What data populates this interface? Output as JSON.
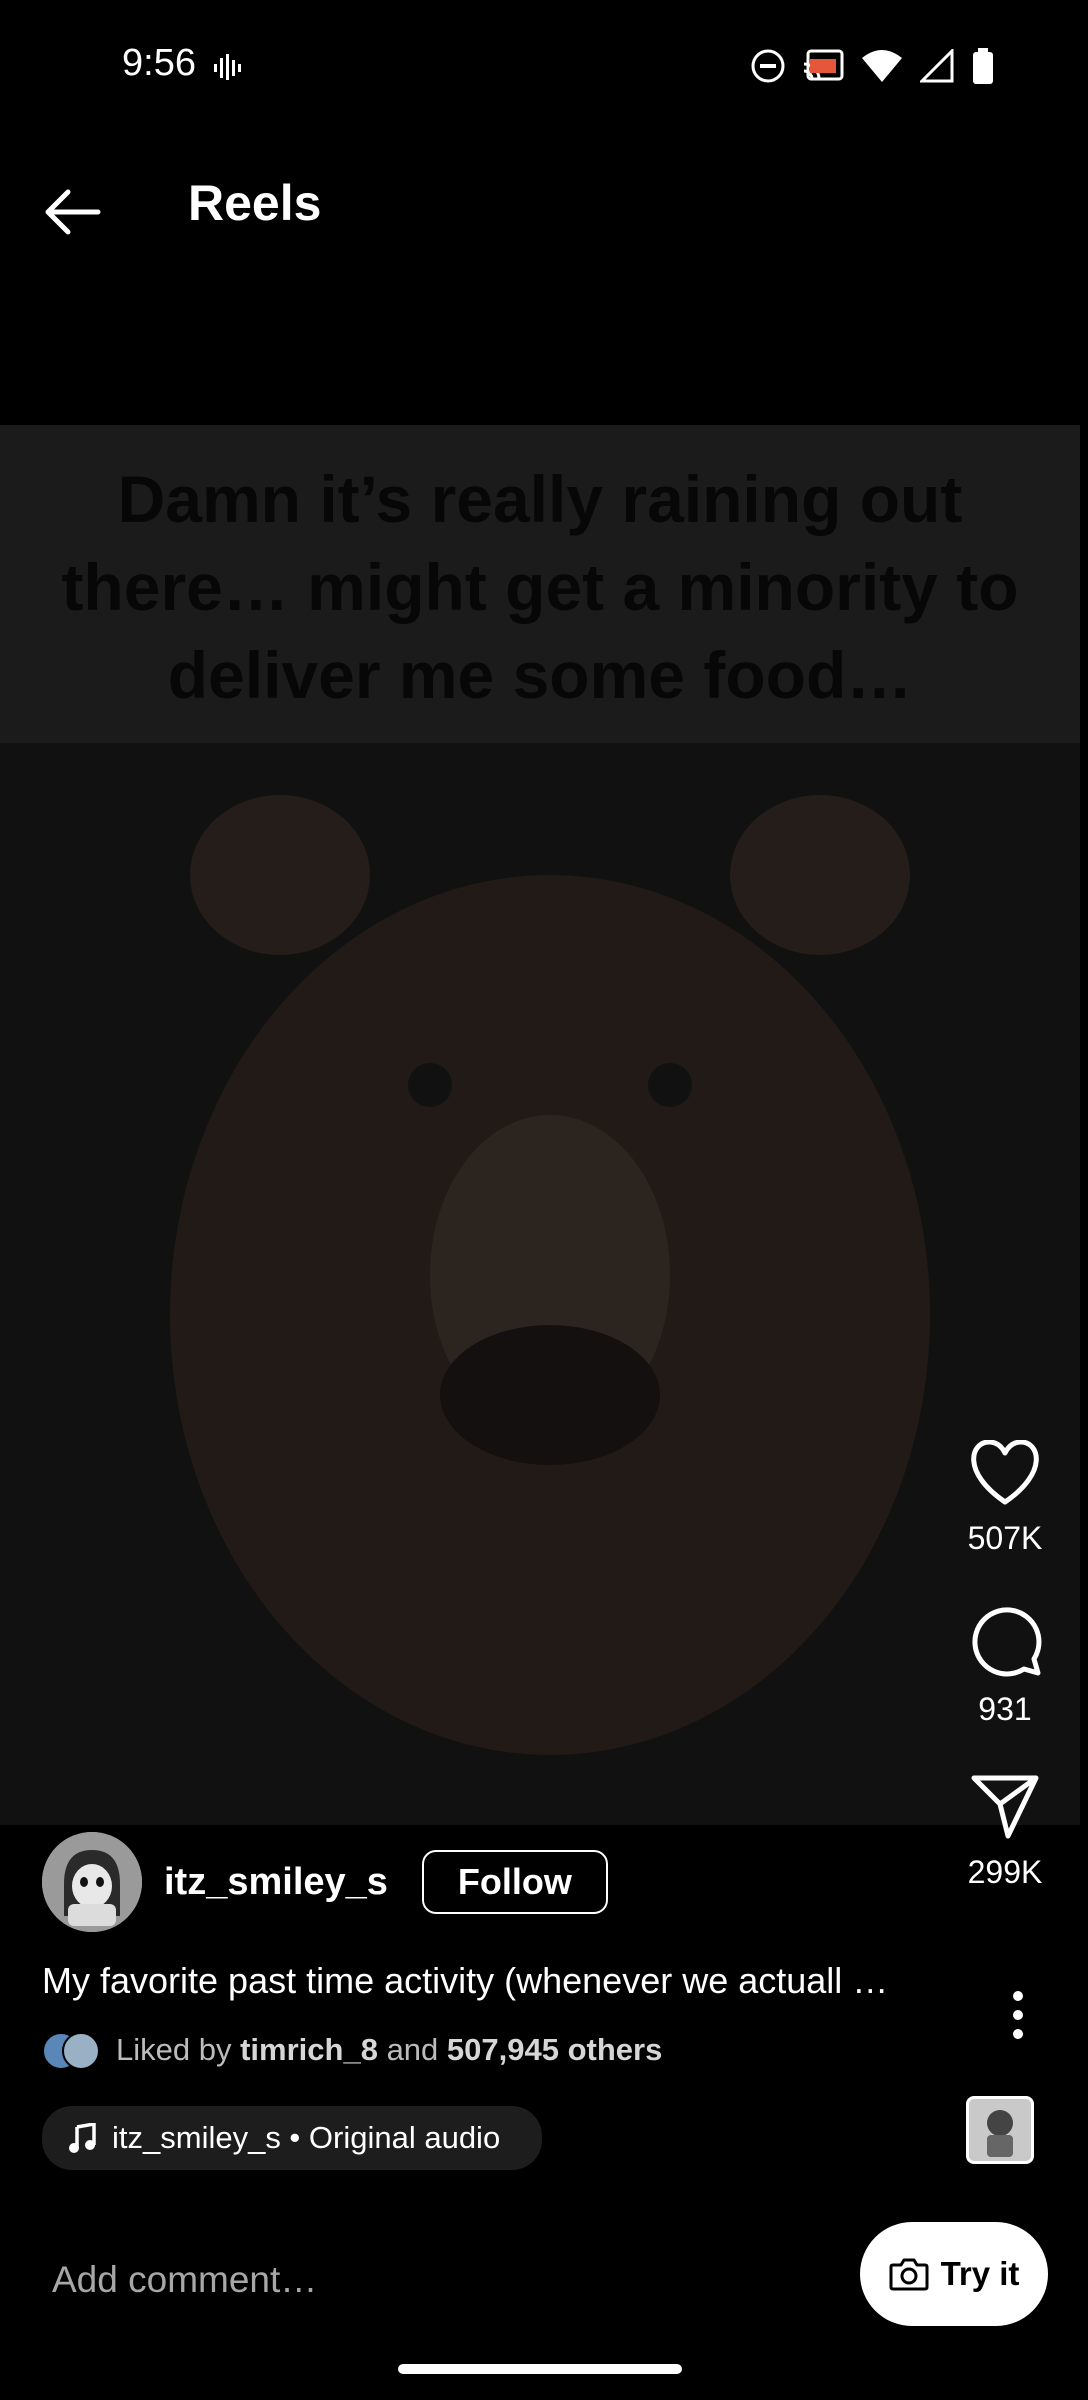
{
  "status_bar": {
    "time": "9:56"
  },
  "header": {
    "title": "Reels"
  },
  "video": {
    "caption": "Damn it’s really raining out there… might get a minority to deliver me some food…"
  },
  "actions": {
    "likes": "507K",
    "comments": "931",
    "shares": "299K"
  },
  "post": {
    "username": "itz_smiley_s",
    "follow_label": "Follow",
    "caption": "My favorite past time activity (whenever we actuall …",
    "liked_by_prefix": "Liked by",
    "liked_by_user": "timrich_8",
    "liked_by_and": "and",
    "liked_by_others": "507,945 others",
    "audio_label": "itz_smiley_s • Original audio"
  },
  "comment": {
    "placeholder": "Add comment…",
    "try_label": "Try it"
  }
}
